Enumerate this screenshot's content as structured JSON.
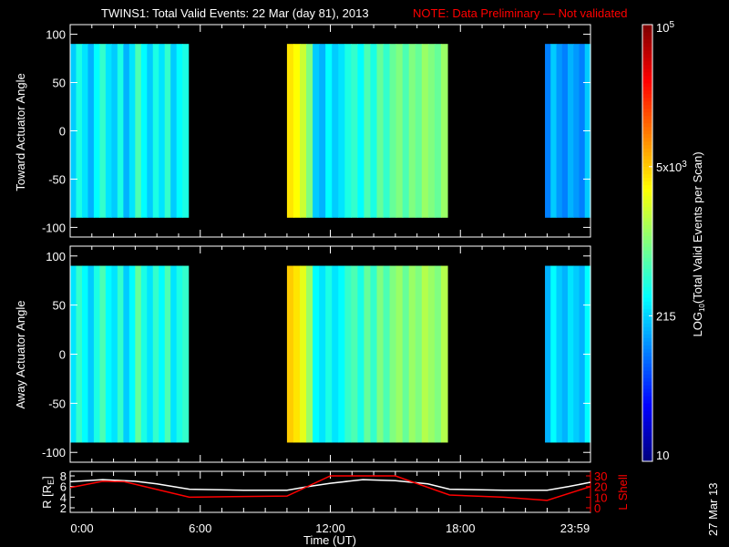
{
  "title": "TWINS1: Total Valid Events: 22 Mar (day  81), 2013",
  "note": "NOTE: Data Preliminary — Not validated",
  "date_stamp": "27 Mar 13",
  "colors": {
    "note": "#ff0000",
    "lshell": "#ff0000",
    "r_line": "#ffffff"
  },
  "chart_data": [
    {
      "type": "heatmap",
      "name": "toward",
      "ylabel": "Toward Actuator Angle",
      "ylim": [
        -110,
        110
      ],
      "yticks": [
        "100",
        "50",
        "0",
        "-50",
        "-100"
      ],
      "ytick_values": [
        100,
        50,
        0,
        -50,
        -100
      ],
      "angle_range": [
        -90,
        90
      ],
      "xlim_hours": [
        0,
        24
      ],
      "blocks": [
        {
          "start": 0.0,
          "end": 5.45,
          "log_values": [
            2.3,
            2.6,
            2.4,
            2.2,
            2.5,
            2.7,
            2.4,
            2.3,
            2.6,
            2.2,
            2.4,
            2.8,
            2.5,
            2.3,
            2.6,
            2.4,
            2.7,
            2.3,
            2.5,
            2.6
          ]
        },
        {
          "start": 10.0,
          "end": 17.4,
          "log_values": [
            3.6,
            3.5,
            3.3,
            3.0,
            2.3,
            2.2,
            2.5,
            2.3,
            2.4,
            2.6,
            2.7,
            2.5,
            2.8,
            2.6,
            2.9,
            2.7,
            2.9,
            3.0,
            2.8,
            3.0,
            2.9,
            3.1,
            3.0,
            2.9,
            3.1
          ]
        },
        {
          "start": 21.9,
          "end": 24.0,
          "log_values": [
            2.0,
            2.3,
            2.1,
            2.0,
            2.2,
            2.1,
            2.0,
            2.3
          ]
        }
      ]
    },
    {
      "type": "heatmap",
      "name": "away",
      "ylabel": "Away Actuator Angle",
      "ylim": [
        -110,
        110
      ],
      "yticks": [
        "100",
        "50",
        "0",
        "-50",
        "-100"
      ],
      "ytick_values": [
        100,
        50,
        0,
        -50,
        -100
      ],
      "angle_range": [
        -90,
        90
      ],
      "xlim_hours": [
        0,
        24
      ],
      "blocks": [
        {
          "start": 0.0,
          "end": 5.45,
          "log_values": [
            2.4,
            2.7,
            2.5,
            2.3,
            2.6,
            2.8,
            2.5,
            2.4,
            2.7,
            2.3,
            2.5,
            2.9,
            2.6,
            2.4,
            2.7,
            2.5,
            2.8,
            2.4,
            2.6,
            2.7
          ]
        },
        {
          "start": 10.0,
          "end": 17.4,
          "log_values": [
            3.7,
            3.6,
            3.4,
            3.1,
            2.5,
            2.4,
            2.6,
            2.4,
            2.5,
            2.7,
            2.8,
            2.6,
            2.9,
            2.7,
            3.0,
            2.8,
            3.0,
            3.1,
            2.9,
            3.1,
            3.0,
            3.2,
            3.1,
            3.0,
            3.2
          ]
        },
        {
          "start": 21.9,
          "end": 24.0,
          "log_values": [
            2.2,
            2.5,
            2.3,
            2.2,
            2.4,
            2.3,
            2.2,
            2.5
          ]
        }
      ]
    },
    {
      "type": "line",
      "name": "orbit",
      "xlabel": "Time (UT)",
      "xticks": [
        "0:00",
        "6:00",
        "12:00",
        "18:00",
        "23:59"
      ],
      "xtick_values": [
        0,
        6,
        12,
        18,
        24
      ],
      "ylabel_left": {
        "main": "R [R",
        "sub": "E",
        "close": "]"
      },
      "ylim_left": [
        2,
        8
      ],
      "yticks_left": [
        "8",
        "6",
        "4",
        "2"
      ],
      "ytick_left_values": [
        8,
        6,
        4,
        2
      ],
      "ylabel_right": "L Shell",
      "ylim_right": [
        0,
        30
      ],
      "yticks_right": [
        "30",
        "20",
        "10",
        "0"
      ],
      "ytick_right_values": [
        30,
        20,
        10,
        0
      ],
      "series": [
        {
          "name": "R",
          "axis": "left",
          "x": [
            0,
            1.5,
            3,
            4,
            5.5,
            8,
            10,
            11,
            12,
            13.5,
            15,
            16.5,
            17.5,
            20,
            22,
            23,
            24
          ],
          "y": [
            6.9,
            7.3,
            7.0,
            6.5,
            5.5,
            5.3,
            5.3,
            6.0,
            6.6,
            7.3,
            7.1,
            6.5,
            5.5,
            5.3,
            5.3,
            6.0,
            6.8
          ]
        },
        {
          "name": "L Shell",
          "axis": "right",
          "x": [
            0,
            1.5,
            2.5,
            5.5,
            7.5,
            10,
            12,
            15,
            17.5,
            20,
            22,
            24
          ],
          "y": [
            19,
            25,
            24.5,
            10,
            10.5,
            11,
            30,
            30,
            12,
            10,
            7,
            20
          ]
        }
      ]
    },
    {
      "type": "colorbar",
      "range_log10": [
        1,
        5
      ],
      "ticks": [
        {
          "value": 10,
          "label": "10"
        },
        {
          "value": 215,
          "label": "215"
        },
        {
          "value": 5000,
          "label": "5x10",
          "exp": "3"
        },
        {
          "value": 100000,
          "label": "10",
          "exp": "5"
        }
      ],
      "label": {
        "pre": "LOG",
        "sub": "10",
        "post": "(Total Valid Events per Scan)"
      }
    }
  ]
}
